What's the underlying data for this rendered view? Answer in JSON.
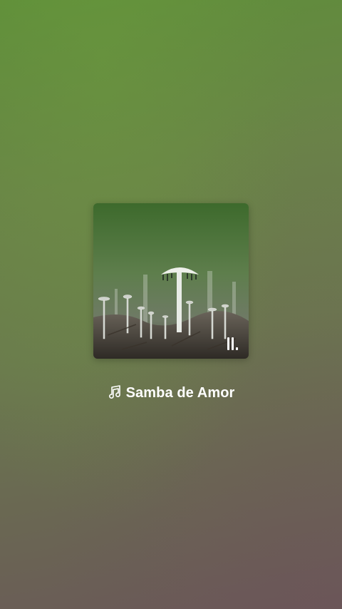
{
  "now_playing": {
    "track_title": "Samba de Amor",
    "music_icon": "music-note-icon",
    "playing_indicator_icon": "equalizer-icon",
    "album_art": "mushroom-photo"
  },
  "colors": {
    "background_top": "#5f8e3a",
    "background_bottom": "#6a5858",
    "text": "#ffffff"
  }
}
